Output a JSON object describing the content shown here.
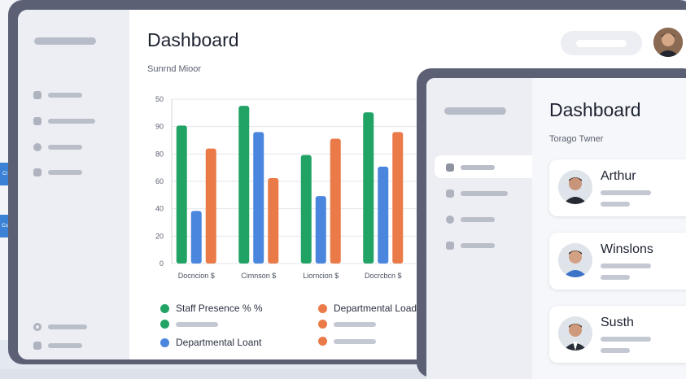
{
  "background": {
    "side_tabs": [
      "Cl",
      "Co"
    ]
  },
  "back_window": {
    "title": "Dashboard",
    "subtitle": "Sunrnd Mioor",
    "search_placeholder": "",
    "avatar": "user-avatar"
  },
  "chart_data": {
    "type": "bar",
    "categories": [
      "Docncion $",
      "Cimnson $",
      "Liorncion $",
      "Docrcbcn $"
    ],
    "series": [
      {
        "name": "Staff Presence % %",
        "color": "#22a366",
        "values": [
          84,
          96,
          66,
          92
        ]
      },
      {
        "name": "",
        "color": "#4a86dd",
        "values": [
          32,
          80,
          41,
          59
        ]
      },
      {
        "name": "Departmental Load",
        "color": "#ea7a48",
        "values": [
          70,
          52,
          76,
          80
        ]
      }
    ],
    "yticks": [
      0,
      20,
      40,
      60,
      80,
      90,
      50
    ],
    "grid": true,
    "legend_position": "bottom"
  },
  "legend": {
    "items": [
      {
        "label": "Staff Presence % %",
        "color": "#22a366"
      },
      {
        "label": "Departmental Load",
        "color": "#ea7a48"
      },
      {
        "label": "",
        "color": "#22a366"
      },
      {
        "label": "",
        "color": "#ea7a48"
      },
      {
        "label": "Departmental Loant",
        "color": "#4a86dd"
      },
      {
        "label": "",
        "color": "#ea7a48"
      }
    ]
  },
  "front_window": {
    "title": "Dashboard",
    "subtitle": "Torago Twner",
    "users": [
      {
        "name": "Arthur"
      },
      {
        "name": "Winslons"
      },
      {
        "name": "Susth"
      }
    ]
  },
  "colors": {
    "window_frame": "#5b6075",
    "sidebar": "#eceef3",
    "green": "#22a366",
    "blue": "#4a86dd",
    "orange": "#ea7a48"
  }
}
